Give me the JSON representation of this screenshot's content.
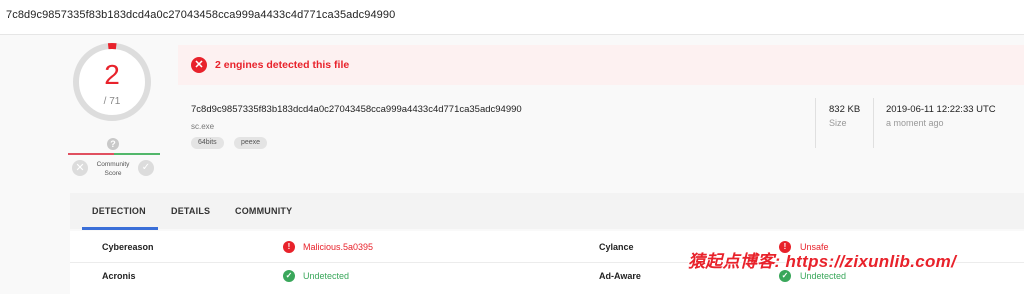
{
  "topbar": {
    "hash": "7c8d9c9857335f83b183dcd4a0c27043458cca999a4433c4d771ca35adc94990"
  },
  "score": {
    "detections": "2",
    "total": "/ 71"
  },
  "community": {
    "label": "Community Score",
    "question_icon": "?",
    "bad_icon": "x-icon",
    "good_icon": "check-icon"
  },
  "alert": {
    "text": "2 engines detected this file"
  },
  "file": {
    "hash": "7c8d9c9857335f83b183dcd4a0c27043458cca999a4433c4d771ca35adc94990",
    "name": "sc.exe",
    "tags": [
      "64bits",
      "peexe"
    ],
    "size": "832 KB",
    "size_label": "Size",
    "date": "2019-06-11 12:22:33 UTC",
    "date_label": "a moment ago"
  },
  "tabs": [
    "DETECTION",
    "DETAILS",
    "COMMUNITY"
  ],
  "detections": [
    {
      "engine": "Cybereason",
      "result": "Malicious.5a0395",
      "status": "bad"
    },
    {
      "engine": "Cylance",
      "result": "Unsafe",
      "status": "bad"
    },
    {
      "engine": "Acronis",
      "result": "Undetected",
      "status": "good"
    },
    {
      "engine": "Ad-Aware",
      "result": "Undetected",
      "status": "good"
    }
  ],
  "watermark": "猿起点博客: https://zixunlib.com/",
  "colors": {
    "danger": "#e8222b",
    "success": "#3aa75b",
    "accent": "#3a6fd8"
  }
}
